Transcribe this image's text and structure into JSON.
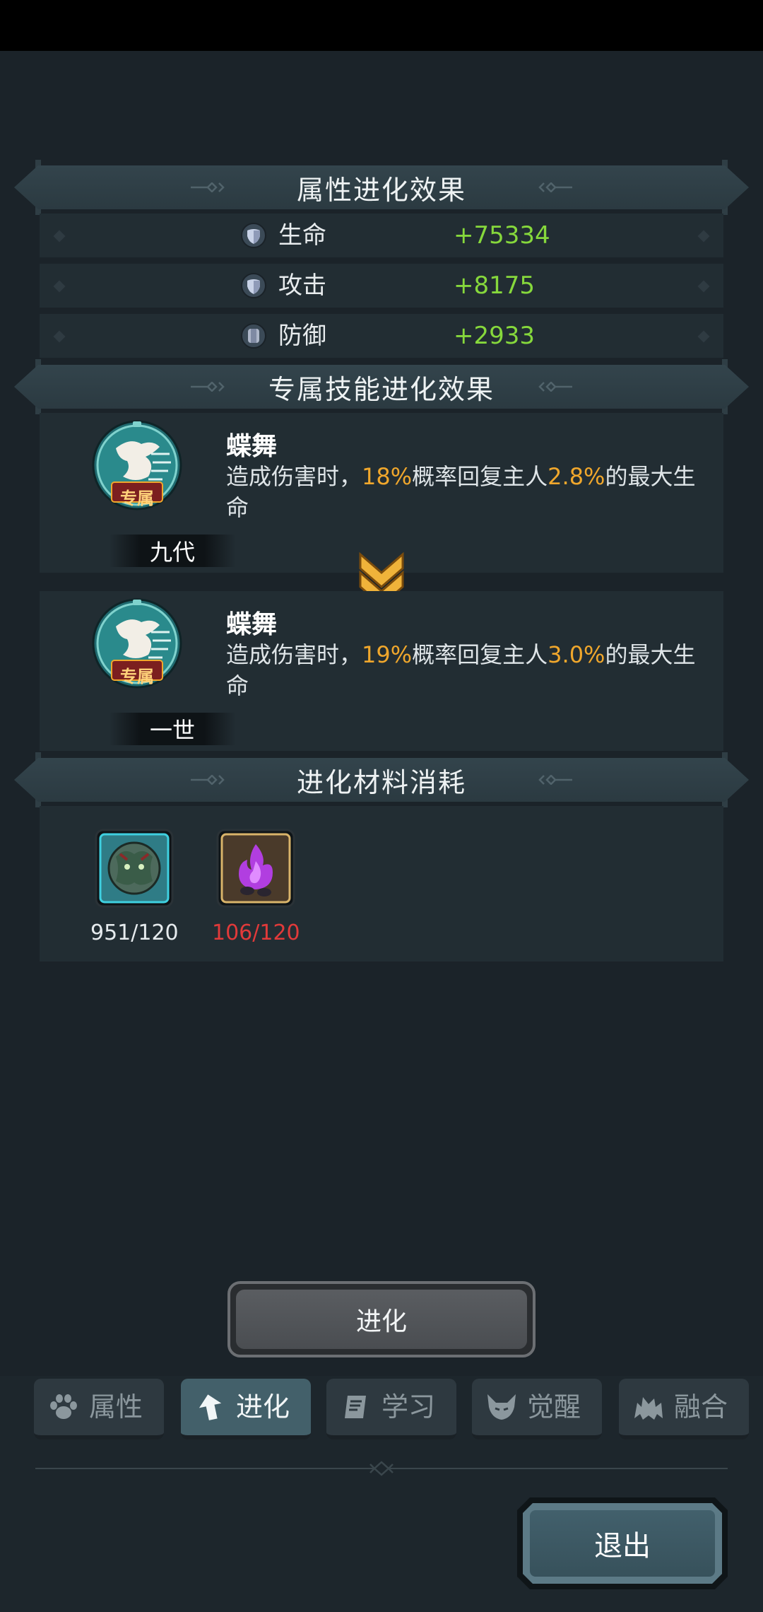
{
  "sections": {
    "attr_title": "属性进化效果",
    "skill_title": "专属技能进化效果",
    "material_title": "进化材料消耗"
  },
  "stats": [
    {
      "label": "生命",
      "value": "+75334",
      "icon": "shield-heart-icon"
    },
    {
      "label": "攻击",
      "value": "+8175",
      "icon": "shield-heart-icon"
    },
    {
      "label": "防御",
      "value": "+2933",
      "icon": "armor-icon"
    }
  ],
  "skills": [
    {
      "badge": "专属",
      "tag": "九代",
      "name": "蝶舞",
      "desc_a": "造成伤害时，",
      "pct1": "18%",
      "desc_b": "概率回复主人",
      "pct2": "2.8%",
      "desc_c": "的最大生命"
    },
    {
      "badge": "专属",
      "tag": "一世",
      "name": "蝶舞",
      "desc_a": "造成伤害时，",
      "pct1": "19%",
      "desc_b": "概率回复主人",
      "pct2": "3.0%",
      "desc_c": "的最大生命"
    }
  ],
  "materials": [
    {
      "count": "951/120",
      "icon": "monster-token-icon",
      "sufficient": true
    },
    {
      "count": "106/120",
      "icon": "purple-flame-icon",
      "sufficient": false
    }
  ],
  "evolve_button": "进化",
  "tabs": [
    {
      "label": "属性",
      "icon": "paw-icon"
    },
    {
      "label": "进化",
      "icon": "arrow-up-icon"
    },
    {
      "label": "学习",
      "icon": "book-icon"
    },
    {
      "label": "觉醒",
      "icon": "horned-mask-icon"
    },
    {
      "label": "融合",
      "icon": "creature-icon"
    }
  ],
  "active_tab": "进化",
  "exit_button": "退出",
  "colors": {
    "positive": "#86d83c",
    "highlight": "#f0a72c",
    "insufficient": "#e13a3a",
    "background": "#1b2329"
  }
}
